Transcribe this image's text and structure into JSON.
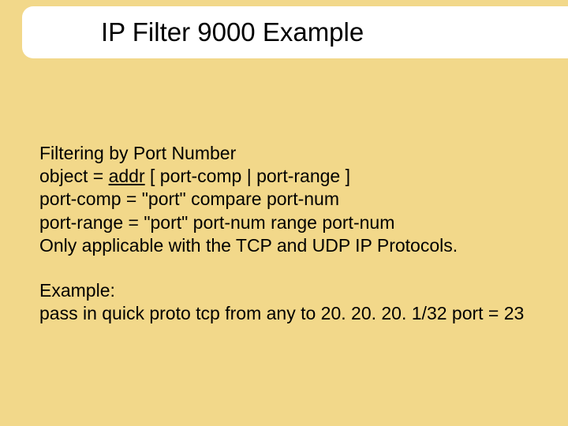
{
  "title": "IP Filter 9000 Example",
  "block1": {
    "line1": "Filtering by Port Number",
    "line2_pre": "object = ",
    "line2_addr": "addr",
    "line2_post": " [ port-comp | port-range ]",
    "line3": "port-comp = \"port\" compare port-num",
    "line4": "port-range = \"port\" port-num range port-num",
    "line5": "Only applicable with the TCP and UDP IP Protocols."
  },
  "block2": {
    "line1": "Example:",
    "line2": "pass in quick proto tcp from any to 20. 20. 20. 1/32 port = 23"
  }
}
